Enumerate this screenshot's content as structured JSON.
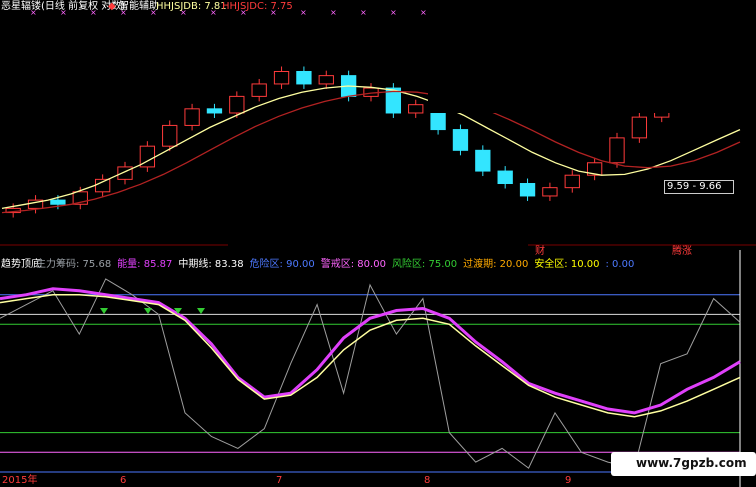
{
  "main_header": {
    "app_name": "恶星辐镂",
    "period": "(日线 前复权 对数)",
    "indicator_name": "智能辅助",
    "hhjsjdb_label": "HHJSJDB: 7.81",
    "hhjsjdc_label": "HHJSJDC: 7.75"
  },
  "sub_header": {
    "title": "趋势顶底",
    "items": [
      {
        "label": "主力筹码: 75.68",
        "color": "#9aa0a6"
      },
      {
        "label": "能量: 85.87",
        "color": "#e040fb"
      },
      {
        "label": "中期线: 83.38",
        "color": "#ffffff"
      },
      {
        "label": "危险区: 90.00",
        "color": "#4d79ff"
      },
      {
        "label": "警戒区: 80.00",
        "color": "#ff66ff"
      },
      {
        "label": "风险区: 75.00",
        "color": "#33cc33"
      },
      {
        "label": "过渡期: 20.00",
        "color": "#ffaa00"
      },
      {
        "label": "安全区: 10.00",
        "color": "#ffff00"
      },
      {
        "label": ": 0.00",
        "color": "#4d79ff"
      }
    ]
  },
  "annotations": {
    "range_label": "9.59 - 9.66",
    "tag_cai": "财",
    "tag_zhangting": "腾涨"
  },
  "x_axis": {
    "labels": [
      "2015年",
      "6",
      "7",
      "8",
      "9"
    ]
  },
  "watermark": "www.7gpzb.com",
  "colors": {
    "up_candle": "#ff3b3b",
    "down_candle": "#33e5ff",
    "ma_fast": "#ffffa0",
    "ma_slow": "#b22222",
    "energy": "#e040fb",
    "mid_line": "#ffffa0",
    "chips": "#9e9e9e"
  },
  "chart_data": [
    {
      "type": "candlestick",
      "title": "",
      "series": [
        {
          "name": "HHJSJDB",
          "values": [
            4.9,
            5.0,
            5.1,
            5.25,
            5.45,
            5.7,
            5.95,
            6.25,
            6.55,
            6.85,
            7.1,
            7.35,
            7.55,
            7.7,
            7.8,
            7.85,
            7.82,
            7.75,
            7.6,
            7.4,
            7.15,
            6.85,
            6.55,
            6.25,
            6.0,
            5.8,
            5.7,
            5.72,
            5.85,
            6.05,
            6.3,
            6.55,
            6.8
          ]
        },
        {
          "name": "HHJSJDC",
          "values": [
            4.8,
            4.85,
            4.92,
            5.0,
            5.12,
            5.28,
            5.48,
            5.72,
            6.0,
            6.3,
            6.6,
            6.88,
            7.12,
            7.32,
            7.48,
            7.6,
            7.68,
            7.72,
            7.7,
            7.62,
            7.48,
            7.28,
            7.04,
            6.78,
            6.5,
            6.25,
            6.05,
            5.92,
            5.88,
            5.92,
            6.05,
            6.25,
            6.5
          ]
        }
      ],
      "candles_close": [
        4.9,
        5.1,
        5.0,
        5.3,
        5.6,
        5.9,
        6.4,
        6.9,
        7.3,
        7.2,
        7.6,
        7.9,
        8.2,
        7.9,
        8.1,
        7.6,
        7.8,
        7.2,
        7.4,
        6.8,
        6.3,
        5.8,
        5.5,
        5.2,
        5.4,
        5.7,
        6.0,
        6.6,
        7.1,
        7.4,
        7.9,
        8.6,
        8.9
      ]
    },
    {
      "type": "line",
      "title": "",
      "ylim": [
        0,
        100
      ],
      "reference_lines": [
        {
          "name": "危险区",
          "value": 90,
          "color": "#4d79ff"
        },
        {
          "name": "警戒区",
          "value": 80,
          "color": "#dddddd"
        },
        {
          "name": "风险区",
          "value": 75,
          "color": "#33cc33"
        },
        {
          "name": "过渡期",
          "value": 20,
          "color": "#33cc33"
        },
        {
          "name": "安全区",
          "value": 10,
          "color": "#ff66ff"
        },
        {
          "name": "zero",
          "value": 0,
          "color": "#4d79ff"
        }
      ],
      "series": [
        {
          "name": "能量",
          "values": [
            88,
            90,
            93,
            92,
            90,
            88,
            86,
            78,
            65,
            48,
            38,
            40,
            52,
            68,
            78,
            82,
            83,
            78,
            66,
            56,
            45,
            40,
            36,
            32,
            30,
            34,
            42,
            48,
            56
          ]
        },
        {
          "name": "中期线",
          "values": [
            86,
            88,
            90,
            90,
            89,
            87,
            85,
            77,
            63,
            47,
            37,
            39,
            48,
            62,
            72,
            77,
            78,
            75,
            64,
            54,
            44,
            38,
            34,
            30,
            28,
            31,
            36,
            42,
            48
          ]
        },
        {
          "name": "主力筹码",
          "values": [
            78,
            85,
            92,
            70,
            98,
            90,
            80,
            30,
            18,
            12,
            22,
            55,
            85,
            40,
            95,
            70,
            88,
            20,
            5,
            12,
            2,
            30,
            10,
            5,
            2,
            55,
            60,
            88,
            76
          ]
        }
      ]
    }
  ]
}
